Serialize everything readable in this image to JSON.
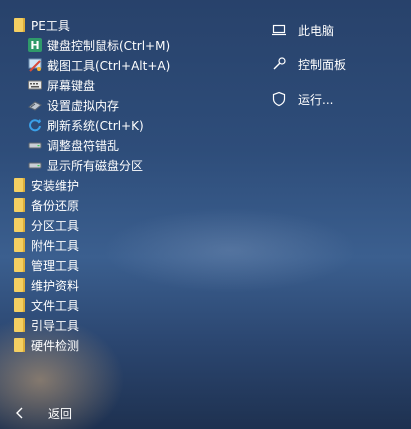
{
  "menu": {
    "pe_folder": "PE工具",
    "pe_items": [
      {
        "label": "键盘控制鼠标(Ctrl+M)",
        "icon": "keyboard-mouse-icon"
      },
      {
        "label": "截图工具(Ctrl+Alt+A)",
        "icon": "screenshot-icon"
      },
      {
        "label": "屏幕键盘",
        "icon": "keyboard-icon"
      },
      {
        "label": "设置虚拟内存",
        "icon": "memory-icon"
      },
      {
        "label": "刷新系统(Ctrl+K)",
        "icon": "refresh-icon"
      },
      {
        "label": "调整盘符错乱",
        "icon": "disk-icon"
      },
      {
        "label": "显示所有磁盘分区",
        "icon": "disk-icon"
      }
    ],
    "folders": [
      "安装维护",
      "备份还原",
      "分区工具",
      "附件工具",
      "管理工具",
      "维护资料",
      "文件工具",
      "引导工具",
      "硬件检测"
    ]
  },
  "right": {
    "computer": "此电脑",
    "control_panel": "控制面板",
    "run": "运行..."
  },
  "back_label": "返回",
  "colors": {
    "folder": "#f4cf62",
    "text": "#ffffff"
  }
}
